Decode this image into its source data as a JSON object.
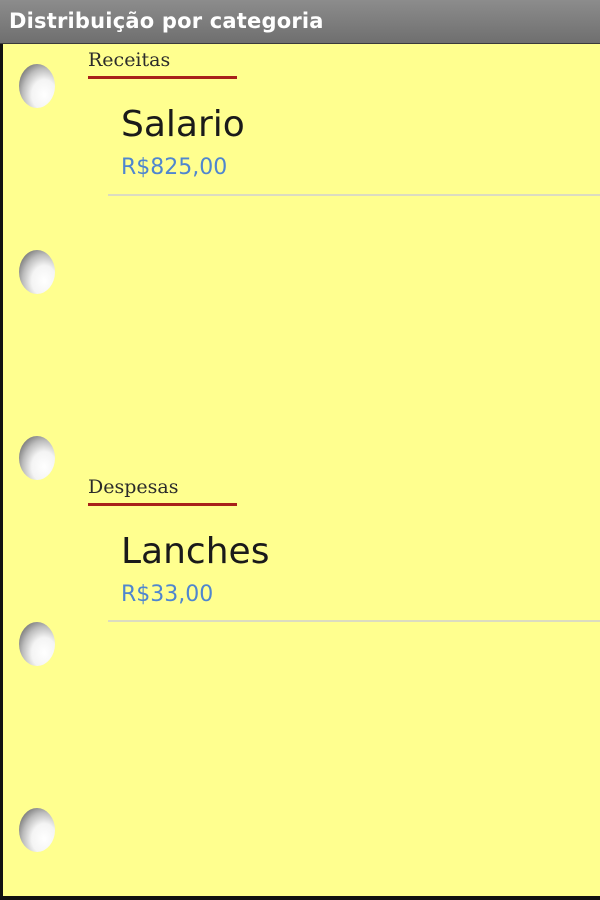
{
  "window": {
    "title": "Distribuição por categoria"
  },
  "colors": {
    "paper": "#ffff8f",
    "section_underline": "#a8201a",
    "value_text": "#4f86cf",
    "title_bar": "#7a7a7a"
  },
  "sections": [
    {
      "header": "Receitas",
      "items": [
        {
          "name": "Salario",
          "value": "R$825,00"
        }
      ]
    },
    {
      "header": "Despesas",
      "items": [
        {
          "name": "Lanches",
          "value": "R$33,00"
        }
      ]
    }
  ],
  "decor": {
    "binder_holes": [
      "binder-hole-icon",
      "binder-hole-icon",
      "binder-hole-icon",
      "binder-hole-icon",
      "binder-hole-icon"
    ]
  }
}
